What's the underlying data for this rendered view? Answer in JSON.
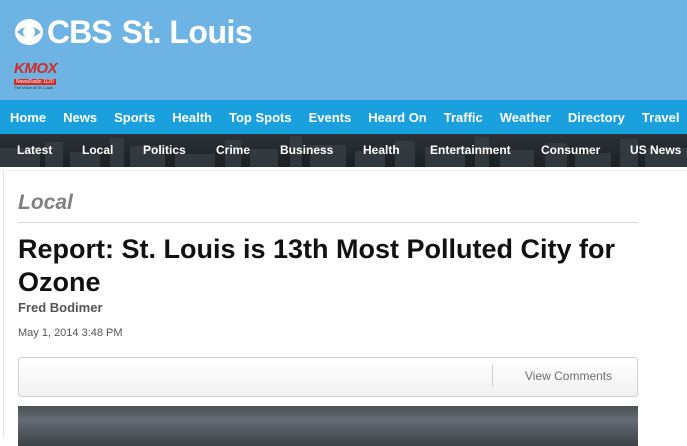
{
  "header": {
    "brand": "CBS",
    "city": "St. Louis",
    "station": {
      "name": "KMOX",
      "subtitle": "NewsRadio 1120",
      "tagline": "The Voice of St. Louis"
    }
  },
  "nav": {
    "items": [
      "Home",
      "News",
      "Sports",
      "Health",
      "Top Spots",
      "Events",
      "Heard On",
      "Traffic",
      "Weather",
      "Directory",
      "Travel"
    ]
  },
  "subnav": {
    "items": [
      "Latest",
      "Local",
      "Politics",
      "Crime",
      "Business",
      "Health",
      "Entertainment",
      "Consumer",
      "US News"
    ]
  },
  "article": {
    "section": "Local",
    "headline": "Report: St. Louis is 13th Most Polluted City for Ozone",
    "author": "Fred Bodimer",
    "timestamp": "May 1, 2014 3:48 PM",
    "comments_label": "View Comments"
  },
  "colors": {
    "header_bg": "#6db3e3",
    "nav_bg": "#1aa0dd",
    "subnav_bg": "#1a1f22",
    "kmox_red": "#d22a24"
  }
}
